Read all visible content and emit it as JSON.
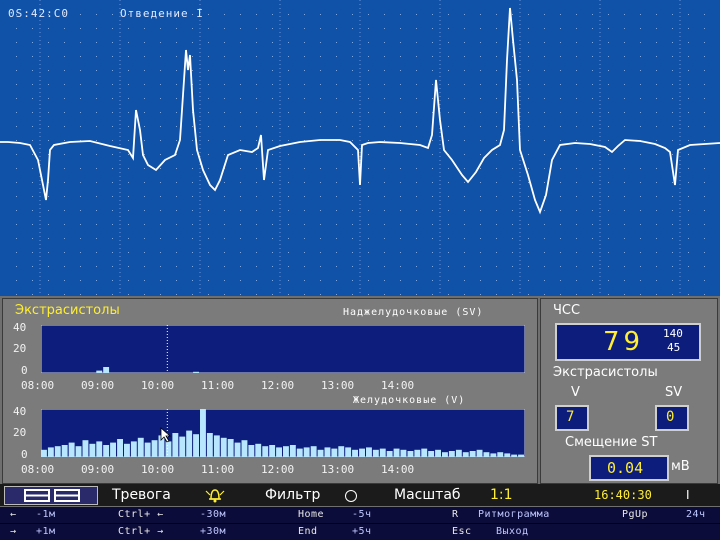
{
  "ecg": {
    "time": "0S:42:C0",
    "lead": "Отведение I"
  },
  "extrasystoles_panel": {
    "title": "Экстрасистолы",
    "supraventricular_title": "Наджелудочковые (SV)",
    "ventricular_title": "Желудочковые (V)",
    "y_ticks": [
      "40",
      "20",
      "0"
    ],
    "time_ticks": [
      "08:00",
      "09:00",
      "10:00",
      "11:00",
      "12:00",
      "13:00",
      "14:00"
    ]
  },
  "chart_data": [
    {
      "type": "bar",
      "title": "Наджелудочковые (SV)",
      "ylim": [
        0,
        40
      ],
      "x_range": [
        "08:00",
        "14:50"
      ],
      "cursor": "09:47",
      "values": [
        0,
        0,
        0,
        0,
        0,
        0,
        0,
        0,
        2,
        5,
        0,
        0,
        0,
        0,
        0,
        0,
        0,
        0,
        0,
        0,
        0,
        0,
        1,
        0,
        0,
        0,
        0,
        0,
        0,
        0,
        0,
        0,
        0,
        0,
        0,
        0,
        0,
        0,
        0,
        0,
        0,
        0,
        0,
        0,
        0,
        0,
        0,
        0,
        0,
        0,
        0,
        0,
        0,
        0,
        0,
        0,
        0,
        0,
        0,
        0,
        0,
        0,
        0,
        0,
        0,
        0,
        0,
        0,
        0,
        0
      ]
    },
    {
      "type": "bar",
      "title": "Желудочковые (V)",
      "ylim": [
        0,
        40
      ],
      "x_range": [
        "08:00",
        "14:50"
      ],
      "cursor": "09:47",
      "values": [
        6,
        8,
        9,
        10,
        12,
        9,
        14,
        11,
        13,
        10,
        12,
        15,
        11,
        13,
        16,
        12,
        14,
        18,
        13,
        20,
        17,
        22,
        19,
        42,
        20,
        18,
        16,
        15,
        12,
        14,
        10,
        11,
        9,
        10,
        8,
        9,
        10,
        7,
        8,
        9,
        6,
        8,
        7,
        9,
        8,
        6,
        7,
        8,
        6,
        7,
        5,
        7,
        6,
        5,
        6,
        7,
        5,
        6,
        4,
        5,
        6,
        4,
        5,
        6,
        4,
        3,
        4,
        3,
        2,
        2
      ]
    }
  ],
  "hr_panel": {
    "label": "ЧСС",
    "value": "79",
    "max": "140",
    "min": "45",
    "extrasystoles_label": "Экстрасистолы",
    "v_label": "V",
    "sv_label": "SV",
    "v_value": "7",
    "sv_value": "0",
    "st_label": "Смещение ST",
    "st_value": "0.04",
    "st_unit": "мВ"
  },
  "status_bar": {
    "alarm": "Тревога",
    "filter": "Фильтр",
    "scale_label": "Масштаб",
    "scale_value": "1:1",
    "clock": "16:40:30",
    "lead_indicator": "I"
  },
  "key_rows": [
    {
      "k1": "←",
      "v1": "-1м",
      "k2": "Ctrl+ ←",
      "v2": "-30м",
      "k3": "Home",
      "v3": "-5ч",
      "k4": "R",
      "v4": "Ритмограмма",
      "k5": "PgUp",
      "v5": "24ч"
    },
    {
      "k1": "→",
      "v1": "+1м",
      "k2": "Ctrl+ →",
      "v2": "+30м",
      "k3": "End",
      "v3": "+5ч",
      "k4": "Esc",
      "v4": "Выход",
      "k5": "",
      "v5": ""
    }
  ],
  "colors": {
    "ecg_bg": "#1052a8",
    "plot_bg": "#0d1d7c",
    "panel_bg": "#7b7b7b",
    "accent_yellow": "#ffee33",
    "bar_color": "#b8e6ff"
  }
}
